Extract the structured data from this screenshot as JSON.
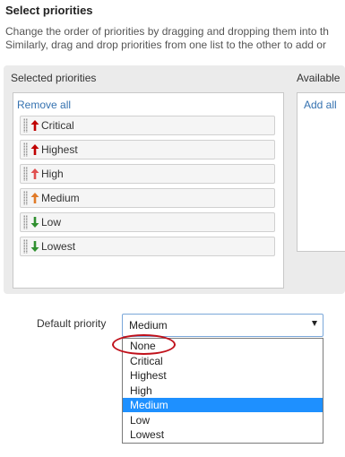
{
  "header": {
    "title": "Select priorities",
    "description_line1": "Change the order of priorities by dragging and dropping them into th",
    "description_line2": "Similarly, drag and drop priorities from one list to the other to add or"
  },
  "selected_panel": {
    "label": "Selected priorities",
    "remove_all": "Remove all",
    "items": [
      {
        "label": "Critical",
        "arrow": "up-arrow-icon",
        "color": "#c00000"
      },
      {
        "label": "Highest",
        "arrow": "up-arrow-icon",
        "color": "#c00000"
      },
      {
        "label": "High",
        "arrow": "up-arrow-icon",
        "color": "#e05050"
      },
      {
        "label": "Medium",
        "arrow": "up-arrow-icon",
        "color": "#e07a28"
      },
      {
        "label": "Low",
        "arrow": "down-arrow-icon",
        "color": "#2f8f2f"
      },
      {
        "label": "Lowest",
        "arrow": "down-arrow-icon",
        "color": "#2f8f2f"
      }
    ]
  },
  "available_panel": {
    "label": "Available",
    "add_all": "Add all"
  },
  "default_priority": {
    "label": "Default priority",
    "value": "Medium",
    "options": [
      "None",
      "Critical",
      "Highest",
      "High",
      "Medium",
      "Low",
      "Lowest"
    ],
    "selected_index": 4,
    "highlight_color": "#1e90ff",
    "annotation_color": "#c0101a"
  }
}
